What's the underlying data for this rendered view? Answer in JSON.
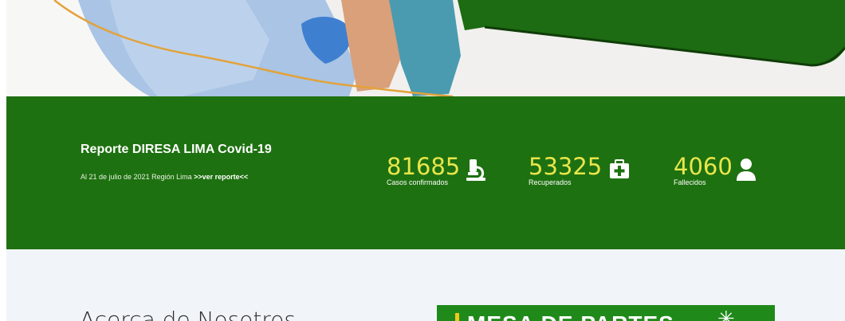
{
  "report": {
    "title": "Reporte DIRESA LIMA Covid-19",
    "subtitle": "Al 21 de julio de 2021 Región Lima",
    "link": ">>ver reporte<<"
  },
  "stats": [
    {
      "value": "81685",
      "label": "Casos confirmados",
      "icon": "microscope-icon"
    },
    {
      "value": "53325",
      "label": "Recuperados",
      "icon": "first-aid-kit-icon"
    },
    {
      "value": "4060",
      "label": "Fallecidos",
      "icon": "user-icon"
    }
  ],
  "about": {
    "title": "Acerca de Nosotros"
  },
  "mesa": {
    "text": "MESA DE PARTES",
    "icon": "sparkle-icon"
  },
  "colors": {
    "band_green": "#1e7110",
    "number_yellow": "#e9e64b",
    "mesa_green": "#1f8a1a",
    "accent_yellow": "#f2c81d"
  }
}
